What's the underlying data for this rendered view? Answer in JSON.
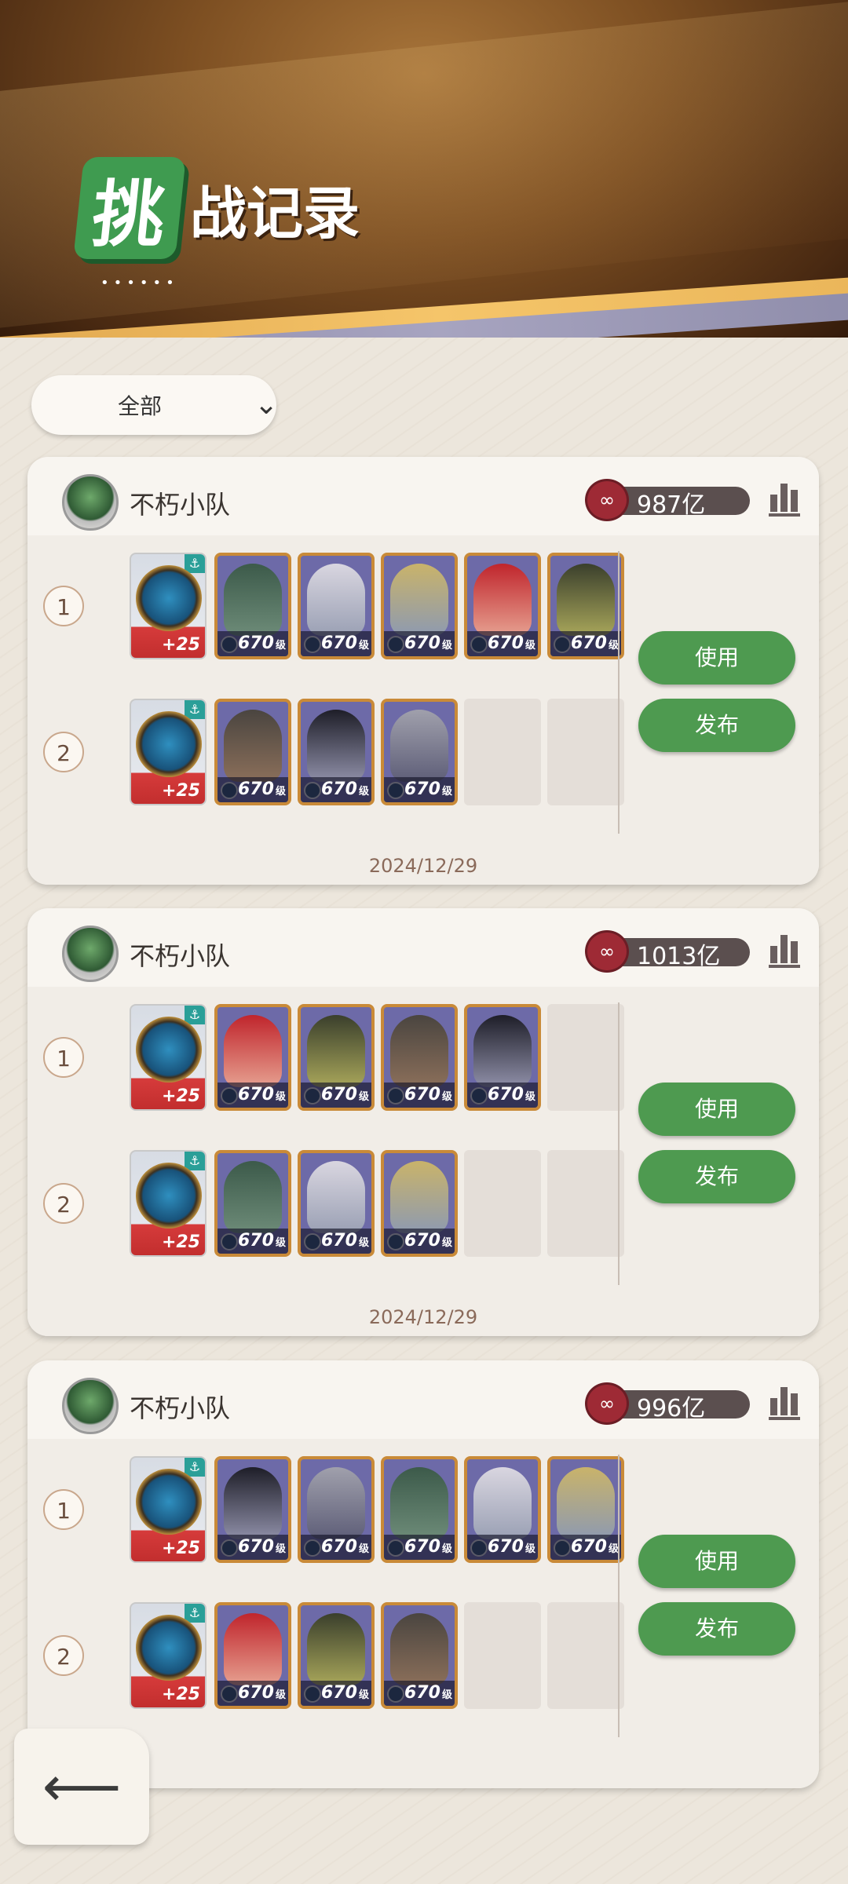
{
  "header": {
    "title_badge": "挑",
    "title_rest": "战记录",
    "dots": "••••••"
  },
  "filter": {
    "label": "全部"
  },
  "records": [
    {
      "team_name": "不朽小队",
      "score": "987亿",
      "date": "2024/12/29",
      "use_label": "使用",
      "publish_label": "发布",
      "rows": [
        {
          "num": "1",
          "artifact_bonus": "+25",
          "heroes": [
            "670",
            "670",
            "670",
            "670",
            "670"
          ],
          "empty": 0
        },
        {
          "num": "2",
          "artifact_bonus": "+25",
          "heroes": [
            "670",
            "670",
            "670"
          ],
          "empty": 2
        }
      ]
    },
    {
      "team_name": "不朽小队",
      "score": "1013亿",
      "date": "2024/12/29",
      "use_label": "使用",
      "publish_label": "发布",
      "rows": [
        {
          "num": "1",
          "artifact_bonus": "+25",
          "heroes": [
            "670",
            "670",
            "670",
            "670"
          ],
          "empty": 1
        },
        {
          "num": "2",
          "artifact_bonus": "+25",
          "heroes": [
            "670",
            "670",
            "670"
          ],
          "empty": 2
        }
      ]
    },
    {
      "team_name": "不朽小队",
      "score": "996亿",
      "date": "",
      "use_label": "使用",
      "publish_label": "发布",
      "rows": [
        {
          "num": "1",
          "artifact_bonus": "+25",
          "heroes": [
            "670",
            "670",
            "670",
            "670",
            "670"
          ],
          "empty": 0
        },
        {
          "num": "2",
          "artifact_bonus": "+25",
          "heroes": [
            "670",
            "670",
            "670"
          ],
          "empty": 2
        }
      ]
    }
  ],
  "level_suffix": "级",
  "back_icon": "back-arrow-icon",
  "colors": {
    "accent_green": "#4e9a50",
    "title_green": "#3f9b50",
    "frame_gold": "#c98a38"
  }
}
